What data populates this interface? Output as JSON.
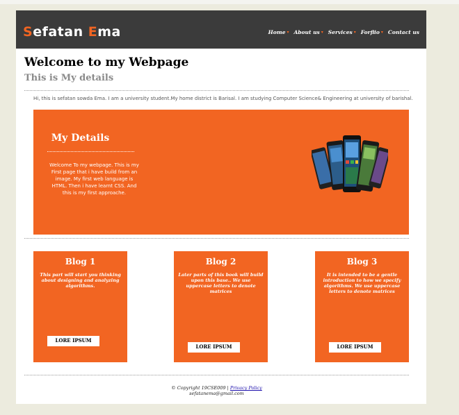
{
  "header": {
    "logo_first_initial": "S",
    "logo_first_rest": "efatan ",
    "logo_second_initial": "E",
    "logo_second_rest": "ma",
    "nav": [
      {
        "label": "Home"
      },
      {
        "label": "About us"
      },
      {
        "label": "Services"
      },
      {
        "label": "Forflio"
      },
      {
        "label": "Contact us"
      }
    ]
  },
  "main": {
    "title": "Welcome to my Webpage",
    "subtitle": "This is My details",
    "intro": "Hi, this is sefatan sowda Ema. I am a university student.My home district is Barisal. I am studying Computer Science& Engineering at university of barishal."
  },
  "hero": {
    "title": "My Details",
    "text": "Welcome To my webpage. This is my First page that i have build from an image. My first web language is HTML. Then i have learnt CSS. And this is my first approache."
  },
  "blogs": [
    {
      "title": "Blog 1",
      "text": "This part will start you thinking about designing and analyzing algorithms.",
      "button": "LORE IPSUM"
    },
    {
      "title": "Blog 2",
      "text": "Later parts of this book will build upon this base.. We use uppercase letters to denote matrices",
      "button": "LORE IPSUM"
    },
    {
      "title": "Blog 3",
      "text": "It is intended to be a gentle introduction to how we specify algorithms. We use uppercase letters to denote matrices",
      "button": "LORE IPSUM"
    }
  ],
  "footer": {
    "copyright": "© Copyright 19CSE009 | ",
    "privacy_link": "Privacy Policy",
    "email": "sefatanema@gmail.com"
  },
  "colors": {
    "accent": "#f26522",
    "header_bg": "#3b3b3b",
    "page_bg": "#ecebde"
  }
}
